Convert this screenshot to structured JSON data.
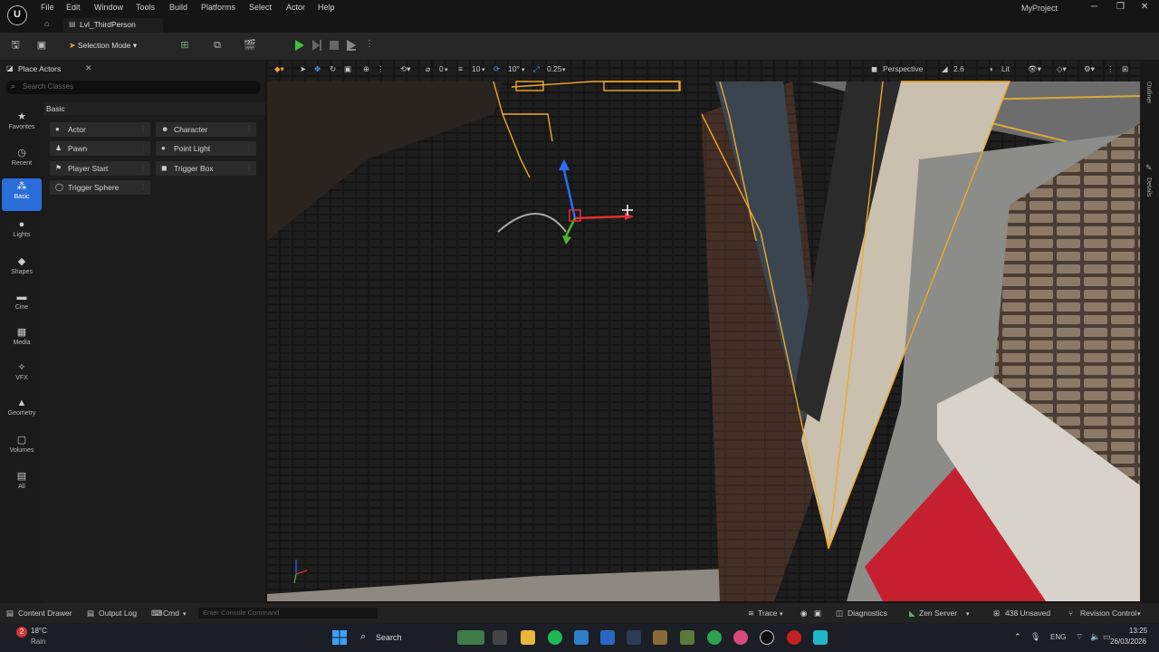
{
  "menu": [
    "File",
    "Edit",
    "Window",
    "Tools",
    "Build",
    "Platforms",
    "Select",
    "Actor",
    "Help"
  ],
  "logo_letter": "U",
  "level_tab": "Lvl_ThirdPerson",
  "project_name": "MyProject",
  "window_controls": {
    "minimize": "─",
    "restore": "❐",
    "close": "✕"
  },
  "toolbar": {
    "selection_mode": "Selection Mode"
  },
  "place_actors": {
    "title": "Place Actors",
    "search_placeholder": "Search Classes",
    "section": "Basic",
    "categories": [
      "Favorites",
      "Recent",
      "Basic",
      "Lights",
      "Shapes",
      "Cine",
      "Media",
      "VFX",
      "Geometry",
      "Volumes",
      "All"
    ],
    "items_left": [
      "Actor",
      "Pawn",
      "Player Start",
      "Trigger Sphere"
    ],
    "items_right": [
      "Character",
      "Point Light",
      "Trigger Box"
    ]
  },
  "viewport": {
    "translate_snap": "10",
    "rotate_snap": "10°",
    "scale_snap": "0.25",
    "angle_value": "0",
    "perspective": "Perspective",
    "camera_speed": "2.6",
    "view_mode": "Lit"
  },
  "side_tabs": {
    "outliner": "Outliner",
    "details": "Details"
  },
  "bottom": {
    "content_drawer": "Content Drawer",
    "output_log": "Output Log",
    "cmd": "Cmd",
    "console_placeholder": "Enter Console Command",
    "trace": "Trace",
    "diagnostics": "Diagnostics",
    "zen_server": "Zen Server",
    "unsaved": "438 Unsaved",
    "revision_control": "Revision Control"
  },
  "taskbar": {
    "weather_temp": "18°C",
    "weather_desc": "Rain",
    "search": "Search",
    "lang": "ENG",
    "time": "13:25",
    "date": "26/03/2026"
  },
  "colors": {
    "accent": "#2a6dd8",
    "play": "#3fbf3f",
    "selection_outline": "#f0a92a"
  }
}
